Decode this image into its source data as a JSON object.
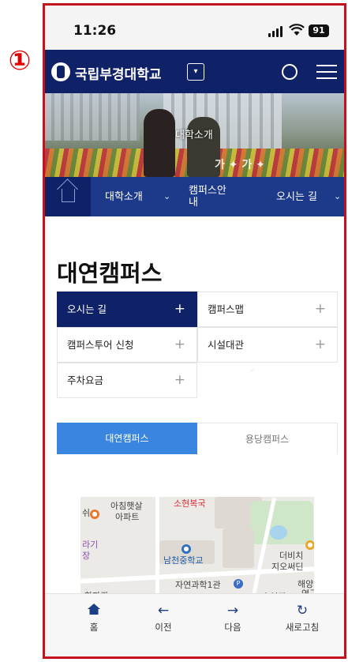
{
  "annotation_marker": "①",
  "status_bar": {
    "time": "11:26",
    "battery": "91"
  },
  "header": {
    "logo_text": "국립부경대학교"
  },
  "hero": {
    "title": "대학소개",
    "deco_text": "가 ✦ 가 ✦"
  },
  "subnav": {
    "items": [
      {
        "label": "대학소개"
      },
      {
        "label": "캠퍼스안 내"
      },
      {
        "label": "오시는 길"
      }
    ]
  },
  "page": {
    "title": "대연캠퍼스"
  },
  "menu": {
    "items": [
      {
        "label": "오시는 길",
        "active": true
      },
      {
        "label": "캠퍼스맵",
        "active": false
      },
      {
        "label": "캠퍼스투어 신청",
        "active": false
      },
      {
        "label": "시설대관",
        "active": false
      },
      {
        "label": "주차요금",
        "active": false
      }
    ],
    "plus_symbol": "+"
  },
  "tabs": {
    "items": [
      {
        "label": "대연캠퍼스"
      },
      {
        "label": "용당캠퍼스"
      }
    ]
  },
  "map": {
    "labels": {
      "apt1": "아침햇살",
      "apt2": "아파트",
      "top_red": "소현복국",
      "left1": "쉬",
      "left2": "라기",
      "left3": "장",
      "school": "남천중학교",
      "right1": "더비치",
      "right2": "지오써딘",
      "bld": "자연과학1관",
      "bottom_left": "학파관",
      "bottom_mid": "호연관",
      "right3": "해양과",
      "right4": "연구"
    }
  },
  "bottom_bar": {
    "items": [
      {
        "icon": "home-icon",
        "label": "홈"
      },
      {
        "icon": "arrow-left-icon",
        "label": "이전"
      },
      {
        "icon": "arrow-right-icon",
        "label": "다음"
      },
      {
        "icon": "refresh-icon",
        "label": "새로고침"
      }
    ]
  },
  "colors": {
    "navy": "#0f2167",
    "subnav": "#1d3a8a",
    "tab_blue": "#3a85e0",
    "frame_red": "#c4121e"
  }
}
